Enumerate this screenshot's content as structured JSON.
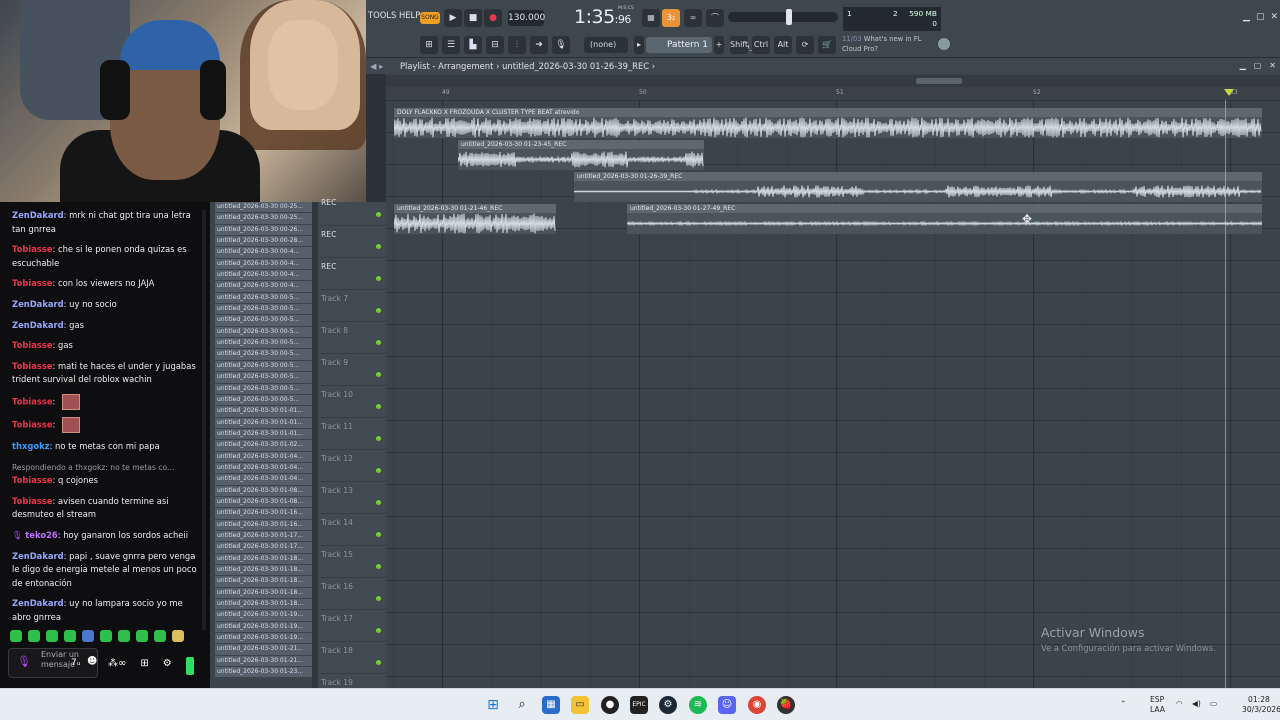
{
  "webcam": {
    "label": "webcam overlay"
  },
  "chat": {
    "messages": [
      {
        "user": "ZenDakard",
        "color": "#9aa6ff",
        "text": "mrk ni chat gpt tira una letra tan gnrrea"
      },
      {
        "user": "Tobiasse",
        "color": "#e8364a",
        "text": "che si le ponen onda quizas es escuchable"
      },
      {
        "user": "Tobiasse",
        "color": "#e8364a",
        "text": "con los viewers no JAJA"
      },
      {
        "user": "ZenDakard",
        "color": "#9aa6ff",
        "text": "uy no socio"
      },
      {
        "user": "ZenDakard",
        "color": "#9aa6ff",
        "text": "gas"
      },
      {
        "user": "Tobiasse",
        "color": "#e8364a",
        "text": "gas"
      },
      {
        "user": "Tobiasse",
        "color": "#e8364a",
        "text": "mati te haces el under y jugabas trident survival del roblox wachin"
      },
      {
        "user": "Tobiasse",
        "color": "#e8364a",
        "text": "",
        "emote": true
      },
      {
        "user": "Tobiasse",
        "color": "#e8364a",
        "text": "",
        "emote": true
      },
      {
        "user": "thxgokz",
        "color": "#3b9bff",
        "text": "no te metas con mi papa"
      },
      {
        "reply": "Respondiendo a thxgokz: no te metas co...",
        "user": "Tobiasse",
        "color": "#e8364a",
        "text": "q cojones"
      },
      {
        "user": "Tobiasse",
        "color": "#e8364a",
        "text": "avisen cuando termine asi desmuteo el stream"
      },
      {
        "user": "teko26",
        "color": "#c070ff",
        "text": "hoy ganaron los sordos acheii",
        "badge": "🎙"
      },
      {
        "user": "ZenDakard",
        "color": "#9aa6ff",
        "text": "papi , suave gnrra pero venga le digo de energia metele al menos un poco de entonación"
      },
      {
        "user": "ZenDakard",
        "color": "#9aa6ff",
        "text": "uy no lampara socio yo me abro gnrrea"
      }
    ],
    "input_placeholder": "Enviar un mensaje"
  },
  "browser": {
    "items": [
      "untitled_2026-03-30 00-25...",
      "untitled_2026-03-30 00-25...",
      "untitled_2026-03-30 00-26...",
      "untitled_2026-03-30 00-28...",
      "untitled_2026-03-30 00-4...",
      "untitled_2026-03-30 00-4...",
      "untitled_2026-03-30 00-4...",
      "untitled_2026-03-30 00-4...",
      "untitled_2026-03-30 00-5...",
      "untitled_2026-03-30 00-5...",
      "untitled_2026-03-30 00-5...",
      "untitled_2026-03-30 00-5...",
      "untitled_2026-03-30 00-5...",
      "untitled_2026-03-30 00-5...",
      "untitled_2026-03-30 00-5...",
      "untitled_2026-03-30 00-5...",
      "untitled_2026-03-30 00-5...",
      "untitled_2026-03-30 00-5...",
      "untitled_2026-03-30 01-01...",
      "untitled_2026-03-30 01-01...",
      "untitled_2026-03-30 01-01...",
      "untitled_2026-03-30 01-02...",
      "untitled_2026-03-30 01-04...",
      "untitled_2026-03-30 01-04...",
      "untitled_2026-03-30 01-04...",
      "untitled_2026-03-30 01-08...",
      "untitled_2026-03-30 01-08...",
      "untitled_2026-03-30 01-16...",
      "untitled_2026-03-30 01-16...",
      "untitled_2026-03-30 01-17...",
      "untitled_2026-03-30 01-17...",
      "untitled_2026-03-30 01-18...",
      "untitled_2026-03-30 01-18...",
      "untitled_2026-03-30 01-18...",
      "untitled_2026-03-30 01-18...",
      "untitled_2026-03-30 01-18...",
      "untitled_2026-03-30 01-19...",
      "untitled_2026-03-30 01-19...",
      "untitled_2026-03-30 01-19...",
      "untitled_2026-03-30 01-21...",
      "untitled_2026-03-30 01-21...",
      "untitled_2026-03-30 01-23..."
    ]
  },
  "tracks": [
    {
      "name": "REC",
      "rec": true
    },
    {
      "name": "REC",
      "rec": true
    },
    {
      "name": "REC",
      "rec": true
    },
    {
      "name": "Track 7"
    },
    {
      "name": "Track 8"
    },
    {
      "name": "Track 9"
    },
    {
      "name": "Track 10"
    },
    {
      "name": "Track 11"
    },
    {
      "name": "Track 12"
    },
    {
      "name": "Track 13"
    },
    {
      "name": "Track 14"
    },
    {
      "name": "Track 15"
    },
    {
      "name": "Track 16"
    },
    {
      "name": "Track 17"
    },
    {
      "name": "Track 18"
    },
    {
      "name": "Track 19"
    }
  ],
  "toolbar": {
    "menu": "TOOLS HELP",
    "song_mode": "SONG",
    "tempo": "130.000",
    "time": "1:35",
    "time_small": ":96",
    "time_mode": "M:S:CS",
    "pattern": "Pattern 1",
    "snap": "(none)",
    "cpu_a": "2",
    "cpu_b": "590 MB",
    "cpu_c": "0",
    "news_date": "11/03",
    "news_title": "What's new in FL",
    "news_sub": "Cloud Pro?",
    "left_rec": "27-49_REC",
    "mods": [
      "Shift",
      "Ctrl",
      "Alt"
    ],
    "cpu_bars": "1"
  },
  "playlist": {
    "title": "Playlist - Arrangement",
    "breadcrumb": "untitled_2026-03-30 01-26-39_REC",
    "bars": [
      "49",
      "50",
      "51",
      "52",
      "53"
    ],
    "clips": [
      {
        "name": "DOLY FLACKKO X FROZOUDA X CLUSTER TYPE BEAT atrevido"
      },
      {
        "name": "untitled_2026-03-30 01-23-45_REC"
      },
      {
        "name": "untitled_2026-03-30 01-26-39_REC"
      },
      {
        "name": "untitled_2026-03-30 01-21-46_REC"
      },
      {
        "name": "untitled_2026-03-30 01-27-49_REC"
      }
    ]
  },
  "watermark": {
    "title": "Activar Windows",
    "sub": "Ve a Configuración para activar Windows."
  },
  "taskbar": {
    "lang": "ESP",
    "lang2": "LAA",
    "time": "01:28",
    "date": "30/3/2026"
  }
}
